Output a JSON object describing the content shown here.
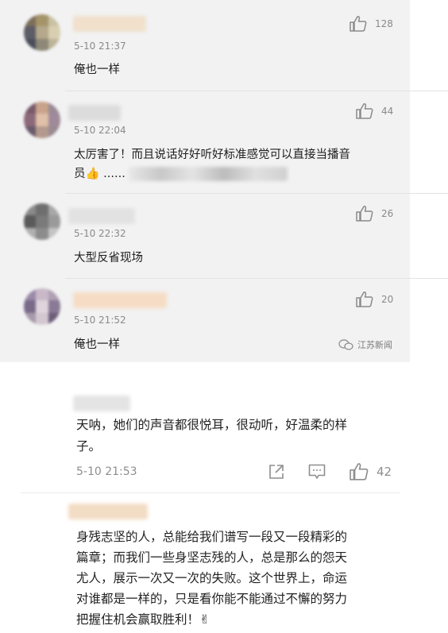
{
  "top_comments": [
    {
      "time": "5-10 21:37",
      "text": "俺也一样",
      "likes": "128",
      "avatar": [
        "#7d6e5a",
        "#a5946a",
        "#c9c2a2",
        "#5d5d66",
        "#b5a88c",
        "#d8cfb0",
        "#4b4e5a",
        "#8d8878",
        "#bdb49a"
      ],
      "nick_color": "#f0e0cc"
    },
    {
      "time": "5-10 22:04",
      "text_line1": "太厉害了！而且说话好好听好标准感觉可以直接当播音",
      "text_line2": "员👍 ......",
      "likes": "44",
      "avatar": [
        "#7a5a6a",
        "#c8a28a",
        "#9b8a96",
        "#8c6a7a",
        "#e0c0a8",
        "#a08a9a",
        "#6a5a6a",
        "#b49a8e",
        "#9a8a92"
      ],
      "nick_color": "#dcdcdc"
    },
    {
      "time": "5-10 22:32",
      "text": "大型反省现场",
      "likes": "26",
      "avatar": [
        "#8a8a8a",
        "#6e6e6e",
        "#a8a8a8",
        "#5a5a5a",
        "#7a7a7a",
        "#9a9a9a",
        "#b0b0b0",
        "#8c8c8c",
        "#c4c4c4"
      ],
      "nick_color": "#e2e2e2"
    },
    {
      "time": "5-10 21:52",
      "text": "俺也一样",
      "likes": "20",
      "avatar": [
        "#9a8aa8",
        "#c8b8c8",
        "#b0a0b4",
        "#7a6a8a",
        "#e0d4dc",
        "#8a7a96",
        "#a89aac",
        "#d4c8d0",
        "#6c5e7a"
      ],
      "nick_color": "#f6dcc4"
    }
  ],
  "watermark": "江苏新闻",
  "bottom_comments": [
    {
      "text_line1": "天呐，她们的声音都很悦耳，很动听，好温柔的样",
      "text_line2": "子。",
      "time": "5-10 21:53",
      "likes": "42",
      "avatar": [
        "#b8bca0",
        "#9ea088",
        "#d4d8c0",
        "#8a8e70",
        "#c8ccb4",
        "#a4a890",
        "#e4e8d4",
        "#b4b8a0",
        "#989c84"
      ],
      "nick_color": "#e4e4e4"
    },
    {
      "text_line1": "身残志坚的人，总能给我们谱写一段又一段精彩的",
      "text_line2": "篇章；而我们一些身坚志残的人，总是那么的怨天",
      "text_line3": "尤人，展示一次又一次的失败。这个世界上，命运",
      "text_line4": "对谁都是一样的，只是看你能不能通过不懈的努力",
      "text_line5": "把握住机会赢取胜利！✌",
      "avatar": [
        "#2a3a4a",
        "#4a5a6a",
        "#3a4a5a",
        "#5a6a7a",
        "#7a8a9a",
        "#6a7a8a",
        "#8a9aaa",
        "#3a4a5a",
        "#4a5a6a"
      ],
      "nick_color": "#f2dcc4"
    }
  ]
}
